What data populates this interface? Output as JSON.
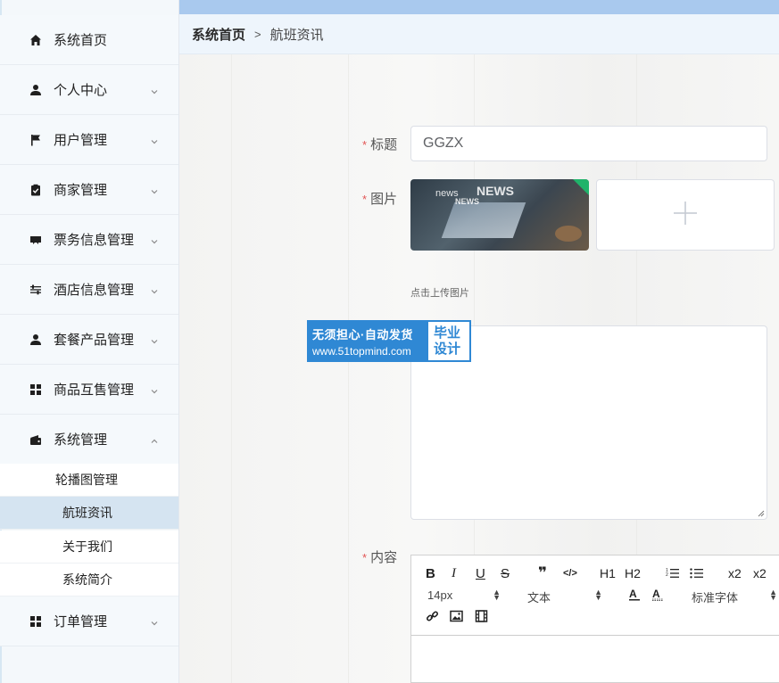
{
  "sidebar": {
    "items": [
      {
        "label": "系统首页",
        "icon": "home-icon"
      },
      {
        "label": "个人中心",
        "icon": "person-icon"
      },
      {
        "label": "用户管理",
        "icon": "flag-icon"
      },
      {
        "label": "商家管理",
        "icon": "clipboard-check-icon"
      },
      {
        "label": "票务信息管理",
        "icon": "ticket-icon"
      },
      {
        "label": "酒店信息管理",
        "icon": "sliders-icon"
      },
      {
        "label": "套餐产品管理",
        "icon": "person-icon"
      },
      {
        "label": "商品互售管理",
        "icon": "grid-icon"
      },
      {
        "label": "系统管理",
        "icon": "wallet-icon"
      },
      {
        "label": "订单管理",
        "icon": "grid-icon"
      }
    ],
    "sub_items": [
      "轮播图管理",
      "航班资讯",
      "关于我们",
      "系统简介"
    ]
  },
  "breadcrumb": {
    "home": "系统首页",
    "separator": ">",
    "current": "航班资讯"
  },
  "form": {
    "title_label": "标题",
    "title_value": "GGZX",
    "image_label": "图片",
    "upload_hint": "点击上传图片",
    "content_label": "内容",
    "required_mark": "*",
    "thumb_words": [
      "NEWS",
      "news",
      "NEWS"
    ]
  },
  "watermark": {
    "line1": "无须担心·自动发货",
    "line2": "www.51topmind.com",
    "badge1": "毕业",
    "badge2": "设计"
  },
  "editor": {
    "buttons": [
      "B",
      "I",
      "U",
      "S",
      "❞",
      "</>",
      "H1",
      "H2",
      "ol",
      "ul",
      "x2",
      "x2"
    ],
    "font_size": "14px",
    "block_type": "文本",
    "font_family": "标准字体"
  },
  "colors": {
    "accent": "#2f88d4",
    "topbar": "#a9c9ee",
    "required": "#e25555",
    "active_sub": "#d5e4f1"
  }
}
